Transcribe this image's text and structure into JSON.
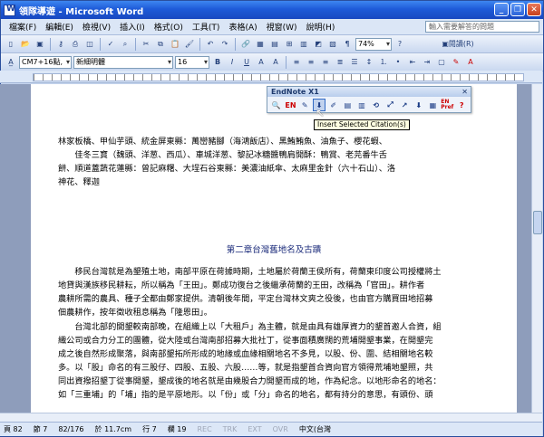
{
  "window": {
    "title": "領隊導遊 - Microsoft Word"
  },
  "menu": [
    "檔案(F)",
    "編輯(E)",
    "檢視(V)",
    "插入(I)",
    "格式(O)",
    "工具(T)",
    "表格(A)",
    "視窗(W)",
    "說明(H)"
  ],
  "help_placeholder": "輸入需要解答的問題",
  "toolbar": {
    "zoom": "74%",
    "read_label": "閱讀(R)",
    "style": "CM7+16點,",
    "font": "新細明體",
    "size": "16"
  },
  "endnote": {
    "title": "EndNote X1",
    "tooltip": "Insert Selected Citation(s)",
    "icons": [
      "find",
      "EN",
      "insert",
      "insert-citation",
      "edit",
      "format",
      "unformat",
      "manage",
      "go",
      "export",
      "cite",
      "library",
      "EN Pref",
      "help"
    ]
  },
  "document": {
    "lines": [
      "林家板橋、甲仙芋頭、統金屏東縣：萬巒豬腳（海鴻飯店）、黑鮪鮪魚、油魚子、櫻花蝦、",
      "　　佳冬三寶（魏頭、洋葱、西瓜）、車城洋葱、黎記冰糖醬鴨肩開酥：鴨賞、老芫番牛舌",
      "餅、順道蓋蔬花蓮縣：曾記麻糬、大埕石谷東縣：美濃油紙傘、太麻里金針（六十石山）、洛",
      "神花、釋迦"
    ],
    "chapter": "第二章台灣舊地名及古蹟",
    "para1": [
      "　　移民台灣就是為墾殖土地，南部平原在荷據時期，土地屬於荷蘭王侯所有，荷蘭東印度公司授權將土",
      "地貸與漢族移民耕耘，所以稱為「王田」。鄭成功復台之後繼承荷蘭的王田，改稱為「官田」。耕作者",
      "農耕所需的農具、種子全都由鄭家提供。清朝後年間，平定台灣林文爽之役後，也由官方購買田地招募",
      "佃農耕作，按年徵收租息稱為「隆恩田」。"
    ],
    "para2": [
      "　　台灣北部的開墾較南部晚，在組織上以「大租戶」為主體，就是由具有雄厚資力的墾首邀人合資，組",
      "織公司或合力分工的團體，從大陸或台灣南部招募大批社丁，從事面積廣闊的荒埔開墾事業，在開墾完",
      "成之後自然形成聚落，與南部墾拓所形成的地緣或血緣相關地名不多見，以股、份、圍、結相關地名較",
      "多。以「股」命名的有三股仔、四股、五股、六股……等，就是指墾首合資向官方領得荒埔地墾照，共",
      "同出資撥招墾丁從事開墾，墾成後的地名就是由幾股合力開墾而成的地，作為紀念。以地形命名的地名：",
      "如「三重埔」的「埔」指的是平原地形。以「份」或「分」命名的地名，都有持分的意思，有頭份、頭"
    ]
  },
  "status": {
    "page": "頁 82",
    "section": "節 7",
    "pages": "82/176",
    "at": "於 11.7cm",
    "line": "行 7",
    "col": "欄 19",
    "rec": "REC",
    "trk": "TRK",
    "ext": "EXT",
    "ovr": "OVR",
    "lang": "中文(台灣"
  }
}
